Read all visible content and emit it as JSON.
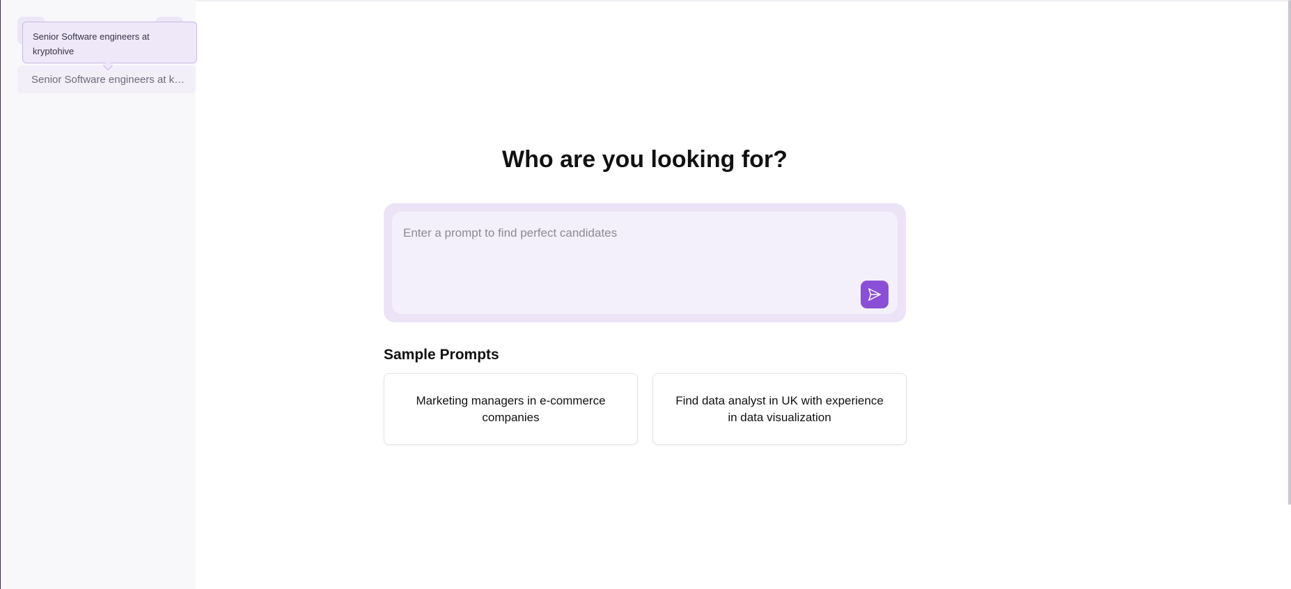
{
  "sidebar": {
    "recent_chat": "Senior Software engineers at kryptohive",
    "tooltip": "Senior Software engineers at kryptohive"
  },
  "main": {
    "title": "Who are you looking for?",
    "prompt_placeholder": "Enter a prompt to find perfect candidates",
    "send_icon": "send-icon",
    "sample_prompts_title": "Sample Prompts",
    "sample_prompts": [
      "Marketing managers in e-commerce companies",
      "Find data analyst in UK with experience in data visualization"
    ]
  },
  "colors": {
    "accent": "#8a4fd6",
    "prompt_bg": "#ece3f7",
    "sidebar_bg": "#f8f8fa"
  }
}
